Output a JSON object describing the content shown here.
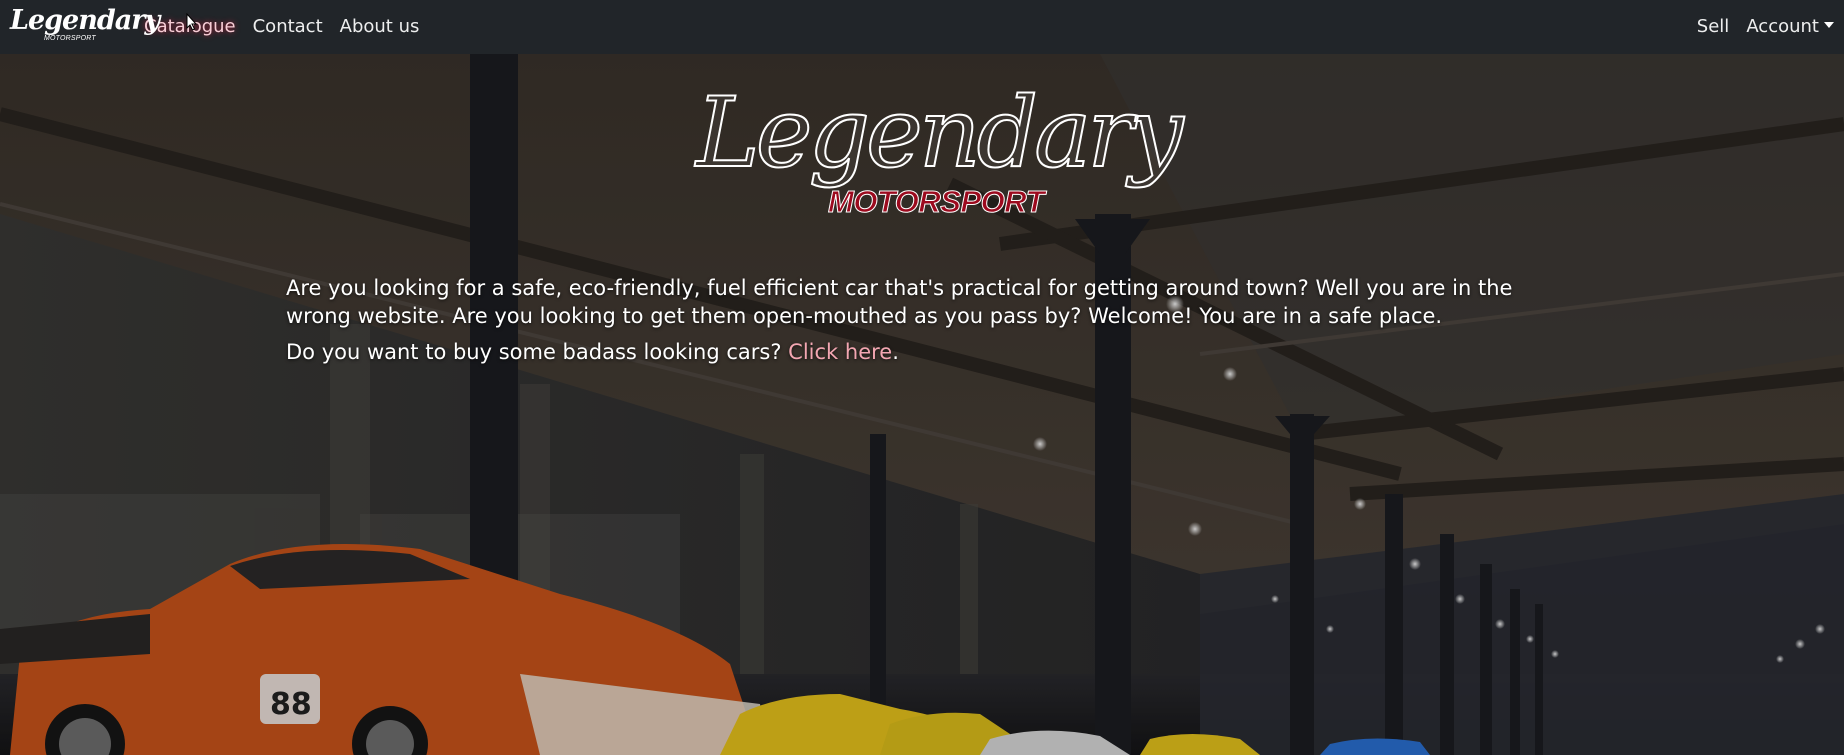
{
  "navbar": {
    "brand": {
      "script": "Legendary",
      "sub": "MOTORSPORT"
    },
    "links": [
      {
        "label": "Catalogue",
        "active": true
      },
      {
        "label": "Contact"
      },
      {
        "label": "About us"
      }
    ],
    "right": {
      "sell_label": "Sell",
      "account_label": "Account"
    }
  },
  "hero": {
    "logo": {
      "script": "Legendary",
      "sub": "MOTORSPORT"
    },
    "intro": "Are you looking for a safe, eco-friendly, fuel efficient car that's practical for getting around town? Well you are in the wrong website. Are you looking to get them open-mouthed as you pass by? Welcome! You are in a safe place.",
    "cta_prefix": "Do you want to buy some badass looking cars? ",
    "cta_link": "Click here",
    "cta_suffix": ".",
    "background_description": "Dim garage hall with rows of racing cars under lights"
  },
  "colors": {
    "navbar_bg": "#212529",
    "accent_link": "#f3a7b2",
    "logo_red": "#9c0a1e"
  },
  "icons": {
    "dropdown": "caret-down-icon",
    "cursor": "mouse-pointer-icon"
  }
}
